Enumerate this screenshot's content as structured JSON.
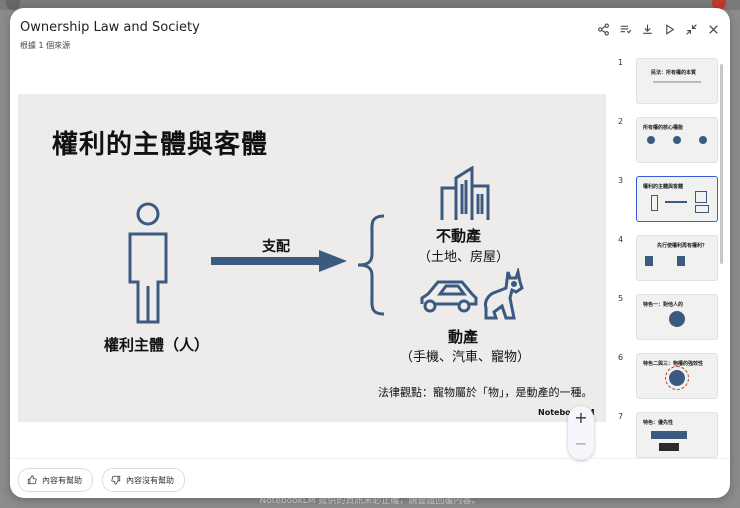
{
  "dialog": {
    "title": "Ownership Law and Society",
    "subtitle": "根據 1 個來源",
    "toolbar_icons": [
      "share-icon",
      "playlist-icon",
      "download-icon",
      "play-icon",
      "collapse-icon",
      "close-icon"
    ]
  },
  "slide": {
    "title": "權利的主體與客體",
    "subject_label": "權利主體（人）",
    "arrow_label": "支配",
    "immovable_title": "不動產",
    "immovable_detail": "（土地、房屋）",
    "movable_title": "動產",
    "movable_detail": "（手機、汽車、寵物）",
    "footnote": "法律觀點：寵物屬於「物」，是動產的一種。",
    "watermark": "NotebookLM"
  },
  "zoom": {
    "plus": "+",
    "minus": "−"
  },
  "thumbnails": [
    {
      "num": "1",
      "title": "民法：所有權的本質"
    },
    {
      "num": "2",
      "title": "所有權的核心權能"
    },
    {
      "num": "3",
      "title": "權利的主體與客體"
    },
    {
      "num": "4",
      "title": "先行使權利再有權利？"
    },
    {
      "num": "5",
      "title": "特色一：對他人的"
    },
    {
      "num": "6",
      "title": "特色二與三：物權的強效性"
    },
    {
      "num": "7",
      "title": "特色：優先性"
    }
  ],
  "selected_thumbnail": "3",
  "feedback": {
    "helpful": "內容有幫助",
    "not_helpful": "內容沒有幫助"
  },
  "background_footer": "NotebookLM 提供的資訊未必正確，請查證回覆內容。"
}
